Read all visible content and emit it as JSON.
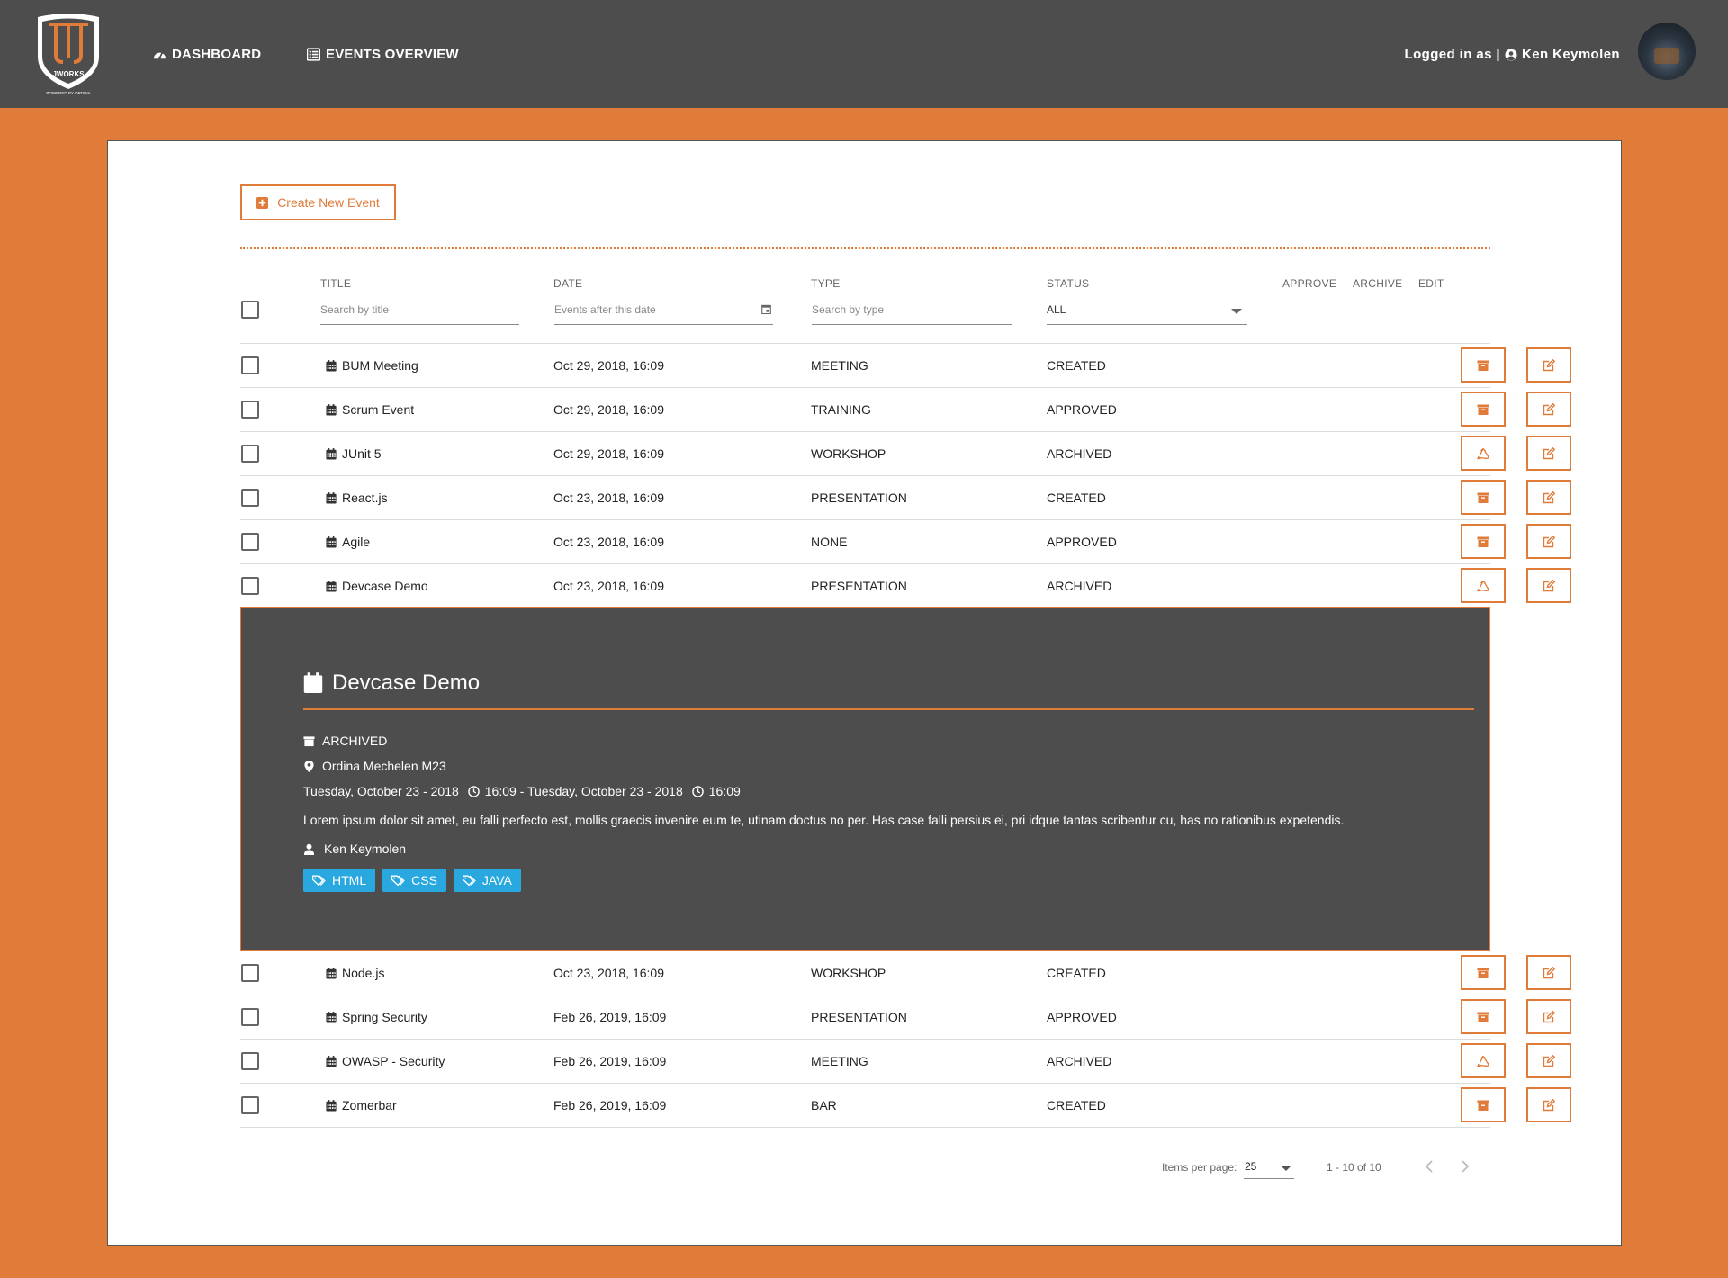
{
  "nav": {
    "logo_text": "JWORKS",
    "logo_sub": "POWERED BY ORDINA",
    "dashboard_label": "DASHBOARD",
    "events_label": "EVENTS OVERVIEW",
    "logged_in_label": "Logged in as |",
    "user_name": "Ken Keymolen"
  },
  "toolbar": {
    "create_label": "Create New Event"
  },
  "table": {
    "headers": {
      "title": "TITLE",
      "date": "DATE",
      "type": "TYPE",
      "status": "STATUS",
      "approve": "APPROVE",
      "archive": "ARCHIVE",
      "edit": "EDIT"
    },
    "filters": {
      "title_placeholder": "Search by title",
      "date_placeholder": "Events after this date",
      "type_placeholder": "Search by type",
      "status_value": "ALL"
    },
    "rows": [
      {
        "title": "BUM Meeting",
        "date": "Oct 29, 2018, 16:09",
        "type": "MEETING",
        "status": "CREATED",
        "archive_icon": "archive-icon"
      },
      {
        "title": "Scrum Event",
        "date": "Oct 29, 2018, 16:09",
        "type": "TRAINING",
        "status": "APPROVED",
        "archive_icon": "archive-icon"
      },
      {
        "title": "JUnit 5",
        "date": "Oct 29, 2018, 16:09",
        "type": "WORKSHOP",
        "status": "ARCHIVED",
        "archive_icon": "recycle-icon"
      },
      {
        "title": "React.js",
        "date": "Oct 23, 2018, 16:09",
        "type": "PRESENTATION",
        "status": "CREATED",
        "archive_icon": "archive-icon"
      },
      {
        "title": "Agile",
        "date": "Oct 23, 2018, 16:09",
        "type": "NONE",
        "status": "APPROVED",
        "archive_icon": "archive-icon"
      },
      {
        "title": "Devcase Demo",
        "date": "Oct 23, 2018, 16:09",
        "type": "PRESENTATION",
        "status": "ARCHIVED",
        "archive_icon": "recycle-icon"
      },
      {
        "title": "Node.js",
        "date": "Oct 23, 2018, 16:09",
        "type": "WORKSHOP",
        "status": "CREATED",
        "archive_icon": "archive-icon"
      },
      {
        "title": "Spring Security",
        "date": "Feb 26, 2019, 16:09",
        "type": "PRESENTATION",
        "status": "APPROVED",
        "archive_icon": "archive-icon"
      },
      {
        "title": "OWASP - Security",
        "date": "Feb 26, 2019, 16:09",
        "type": "MEETING",
        "status": "ARCHIVED",
        "archive_icon": "recycle-icon"
      },
      {
        "title": "Zomerbar",
        "date": "Feb 26, 2019, 16:09",
        "type": "BAR",
        "status": "CREATED",
        "archive_icon": "archive-icon"
      }
    ]
  },
  "detail": {
    "title": "Devcase Demo",
    "status": "ARCHIVED",
    "location": "Ordina Mechelen M23",
    "start_date": "Tuesday, October 23 - 2018",
    "start_time": "16:09 - Tuesday, October 23 - 2018",
    "end_time": "16:09",
    "description": "Lorem ipsum dolor sit amet, eu falli perfecto est, mollis graecis invenire eum te, utinam doctus no per. Has case falli persius ei, pri idque tantas scribentur cu, has no rationibus expetendis.",
    "author": "Ken Keymolen",
    "tags": [
      "HTML",
      "CSS",
      "JAVA"
    ]
  },
  "pagination": {
    "items_per_page_label": "Items per page:",
    "items_per_page_value": "25",
    "range_label": "1 - 10 of 10"
  },
  "colors": {
    "accent": "#e07b3a",
    "header_bg": "#4d4d4d",
    "tag_bg": "#29a8e0"
  }
}
